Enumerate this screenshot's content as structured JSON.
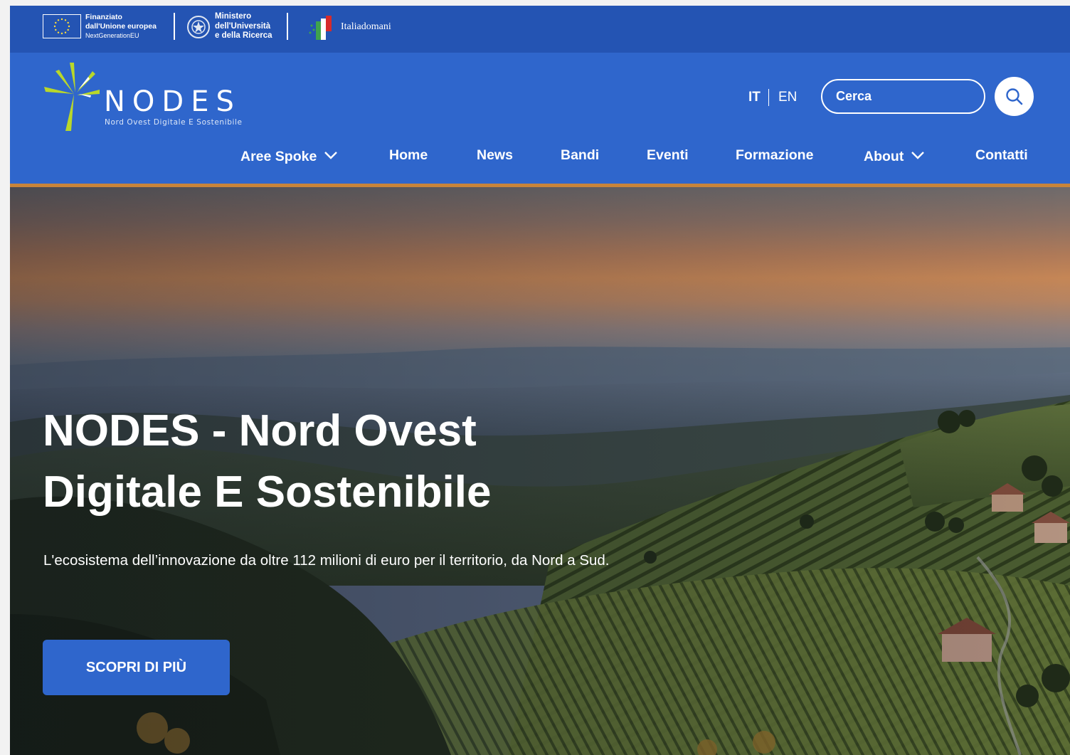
{
  "topbar": {
    "eu": {
      "line1": "Finanziato",
      "line2": "dall'Unione europea",
      "line3": "NextGenerationEU"
    },
    "ministry": {
      "line1": "Ministero",
      "line2": "dell'Università",
      "line3": "e della Ricerca"
    },
    "italiadomani": "Italiadomani"
  },
  "header": {
    "logo_word": "NODES",
    "logo_tagline": "Nord Ovest Digitale E Sostenibile",
    "lang_it": "IT",
    "lang_en": "EN",
    "search_placeholder": "Cerca"
  },
  "nav": {
    "items": [
      {
        "label": "Aree Spoke",
        "dropdown": true
      },
      {
        "label": "Home"
      },
      {
        "label": "News"
      },
      {
        "label": "Bandi"
      },
      {
        "label": "Eventi"
      },
      {
        "label": "Formazione"
      },
      {
        "label": "About",
        "dropdown": true
      },
      {
        "label": "Contatti"
      }
    ]
  },
  "hero": {
    "title_line1": "NODES - Nord Ovest",
    "title_line2": "Digitale E Sostenibile",
    "subtitle": "L'ecosistema dell’innovazione da oltre 112 milioni di euro per il territorio, da Nord a Sud.",
    "cta_label": "SCOPRI DI PIÙ"
  },
  "colors": {
    "brand_blue": "#2f66cc",
    "topbar_blue": "#2454b3",
    "accent_orange": "#c8843a",
    "logo_green": "#b9d72a"
  }
}
